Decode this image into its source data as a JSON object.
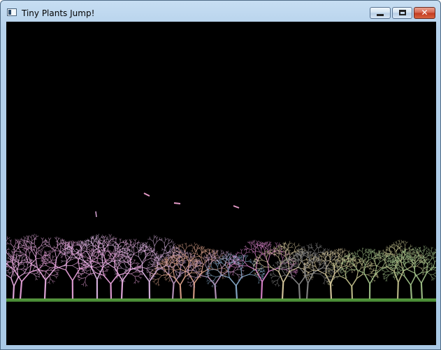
{
  "window": {
    "title": "Tiny Plants Jump!",
    "buttons": {
      "minimize": "minimize",
      "maximize": "maximize",
      "close": "close"
    }
  },
  "icons": {
    "app": "app-window-icon",
    "minimize": "minimize-icon",
    "maximize": "maximize-icon",
    "close": "close-icon"
  },
  "colors": {
    "background": "#000000",
    "ground": "#4a8c36",
    "tree_palette": [
      "#f2a8e4",
      "#f5b6ee",
      "#e8c0f0",
      "#c49ec8",
      "#e3a68f",
      "#8fb4d6",
      "#e58ad6",
      "#e5d6a8",
      "#8c8c8c",
      "#c9c791",
      "#a7c98e"
    ]
  }
}
